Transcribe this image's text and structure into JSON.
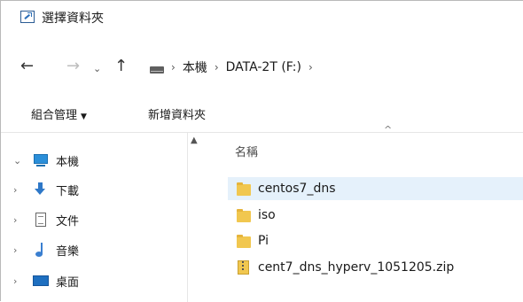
{
  "window": {
    "title": "選擇資料夾",
    "icon": "folder-select-icon"
  },
  "nav_buttons": {
    "back": "←",
    "forward": "→",
    "recent": "⌄",
    "up": "↑"
  },
  "breadcrumb": {
    "items": [
      "本機",
      "DATA-2T (F:)"
    ],
    "separator": "›"
  },
  "commands": {
    "organize": "組合管理",
    "organize_caret": "▼",
    "new_folder": "新增資料夾"
  },
  "navpane": {
    "items": [
      {
        "label": "本機",
        "expanded": true,
        "icon": "pc-icon"
      },
      {
        "label": "下載",
        "icon": "download-icon"
      },
      {
        "label": "文件",
        "icon": "document-icon"
      },
      {
        "label": "音樂",
        "icon": "music-icon"
      },
      {
        "label": "桌面",
        "icon": "desktop-icon"
      }
    ]
  },
  "filelist": {
    "column_name": "名稱",
    "files": [
      {
        "name": "centos7_dns",
        "type": "folder",
        "selected": true
      },
      {
        "name": "iso",
        "type": "folder"
      },
      {
        "name": "Pi",
        "type": "folder"
      },
      {
        "name": "cent7_dns_hyperv_1051205.zip",
        "type": "zip"
      }
    ]
  },
  "colors": {
    "selection": "#e5f1fb",
    "folder": "#f1c74f",
    "accent": "#2b8fd9"
  }
}
